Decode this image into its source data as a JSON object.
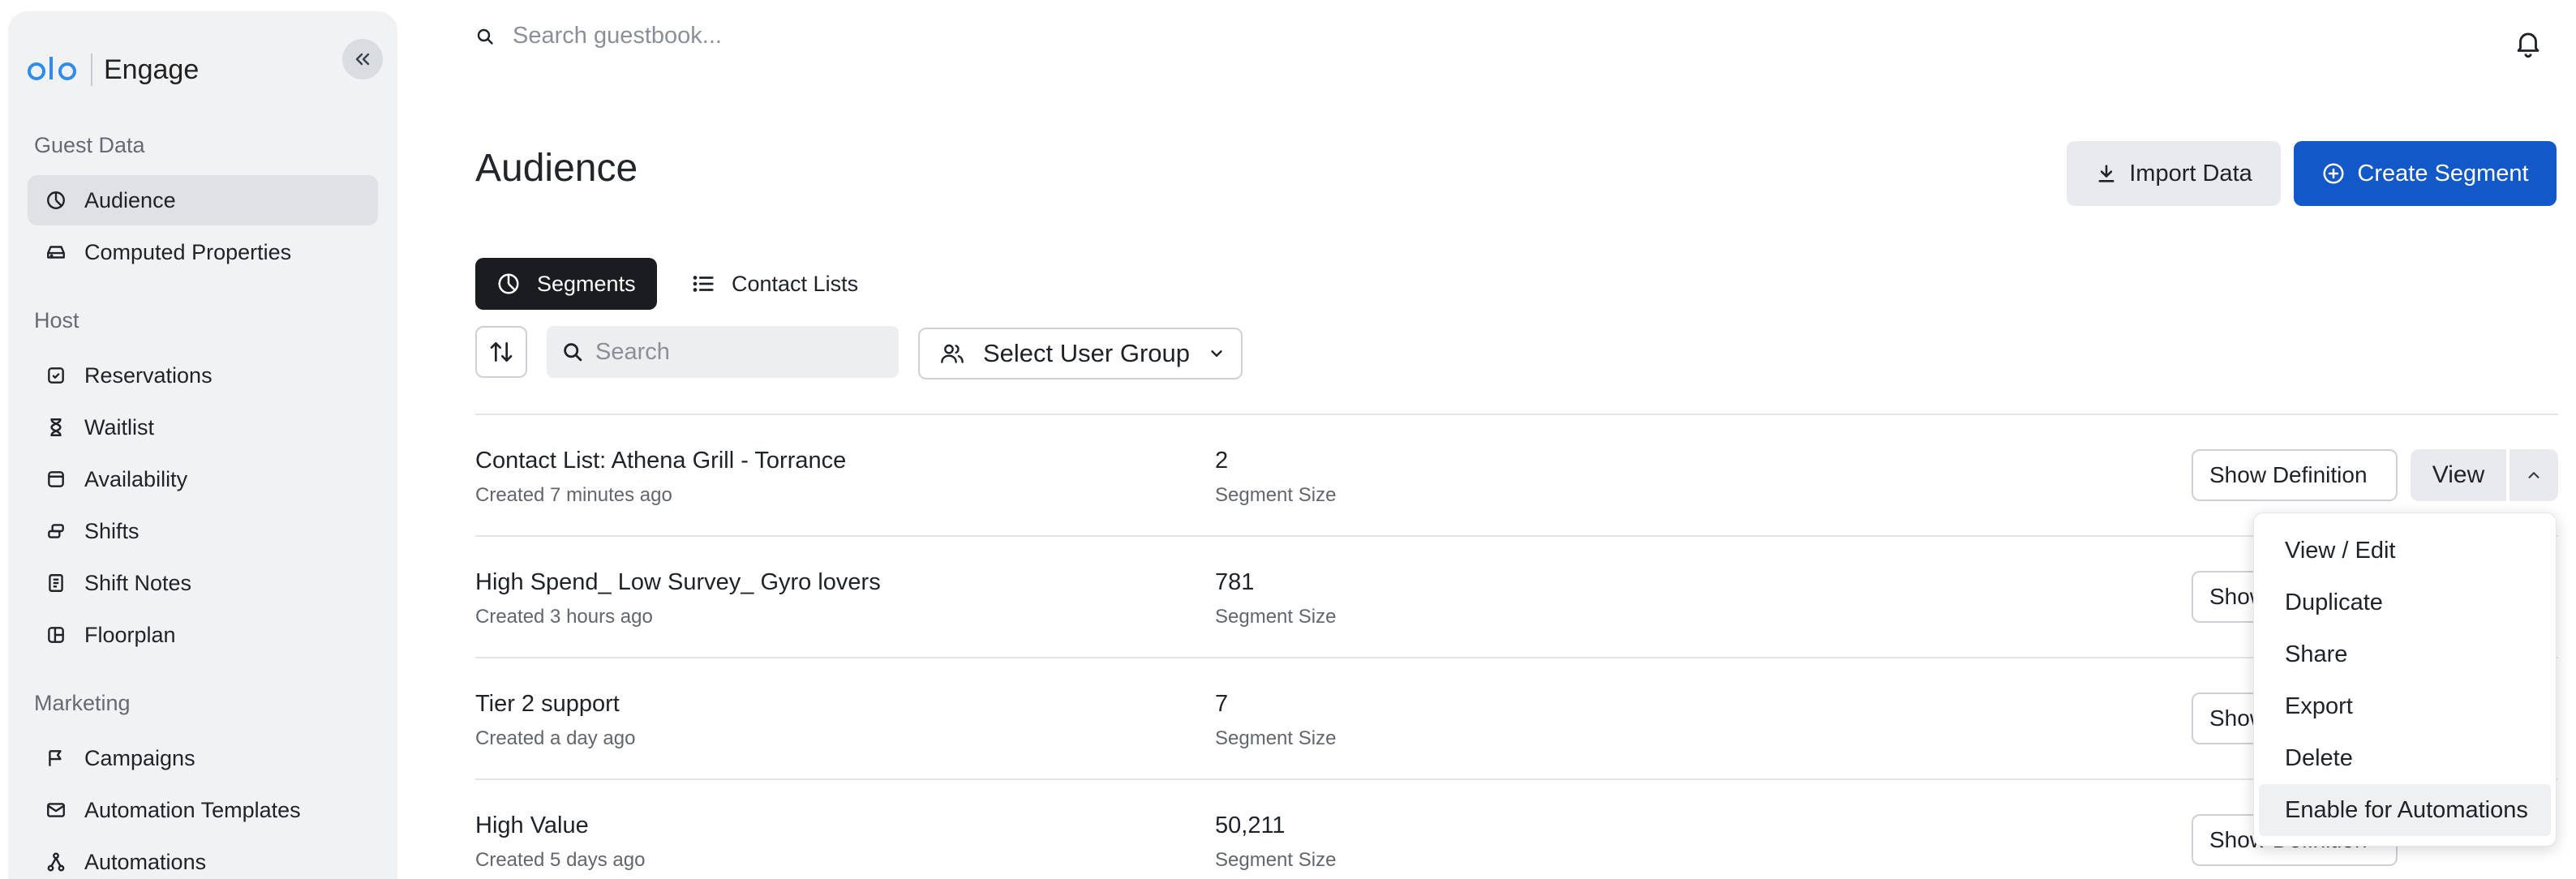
{
  "brand": {
    "name": "Engage"
  },
  "sidebar": {
    "sections": [
      {
        "label": "Guest Data"
      },
      {
        "label": "Host"
      },
      {
        "label": "Marketing"
      }
    ],
    "items": [
      {
        "label": "Audience"
      },
      {
        "label": "Computed Properties"
      },
      {
        "label": "Reservations"
      },
      {
        "label": "Waitlist"
      },
      {
        "label": "Availability"
      },
      {
        "label": "Shifts"
      },
      {
        "label": "Shift Notes"
      },
      {
        "label": "Floorplan"
      },
      {
        "label": "Campaigns"
      },
      {
        "label": "Automation Templates"
      },
      {
        "label": "Automations"
      }
    ]
  },
  "topbar": {
    "search_placeholder": "Search guestbook..."
  },
  "header": {
    "title": "Audience",
    "import_label": "Import Data",
    "create_label": "Create Segment"
  },
  "tabs": [
    {
      "label": "Segments"
    },
    {
      "label": "Contact Lists"
    }
  ],
  "filters": {
    "search_placeholder": "Search",
    "group_select": "Select User Group"
  },
  "rows": [
    {
      "name": "Contact List: Athena Grill - Torrance",
      "created": "Created 7 minutes ago",
      "size": "2",
      "size_label": "Segment Size",
      "show_label": "Show Definition"
    },
    {
      "name": "High Spend_ Low Survey_ Gyro lovers",
      "created": "Created 3 hours ago",
      "size": "781",
      "size_label": "Segment Size",
      "show_label": "Show Definition"
    },
    {
      "name": "Tier 2 support",
      "created": "Created a day ago",
      "size": "7",
      "size_label": "Segment Size",
      "show_label": "Show Definition"
    },
    {
      "name": "High Value",
      "created": "Created 5 days ago",
      "size": "50,211",
      "size_label": "Segment Size",
      "show_label": "Show Definition"
    }
  ],
  "view_label": "View",
  "menu": {
    "items": [
      "View / Edit",
      "Duplicate",
      "Share",
      "Export",
      "Delete",
      "Enable for Automations"
    ]
  },
  "colors": {
    "primary": "#1258c9",
    "logo": "#2d8cf0",
    "sidebar_bg": "#f1f2f4"
  }
}
